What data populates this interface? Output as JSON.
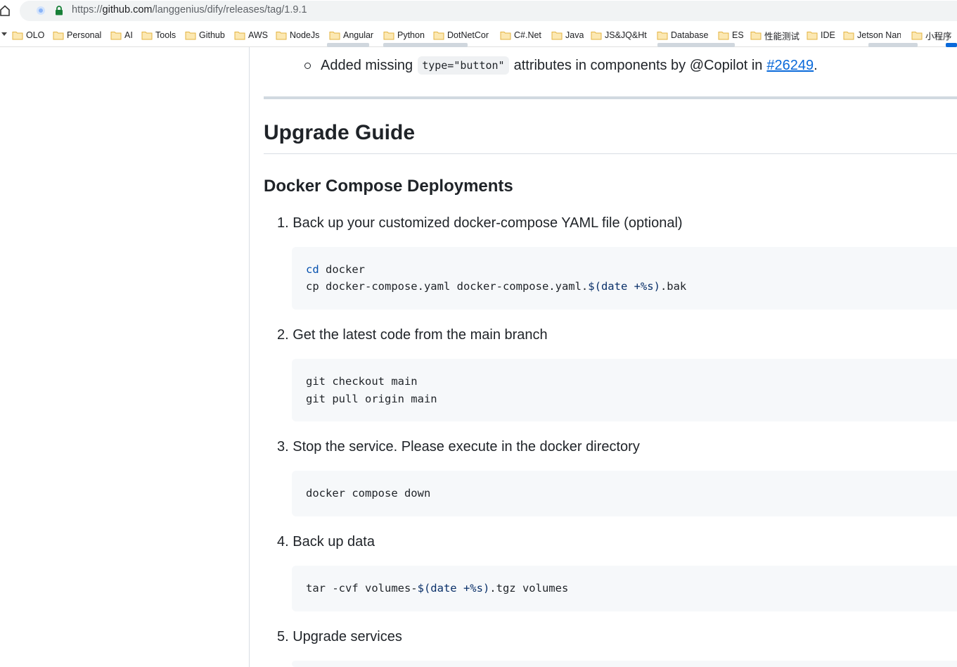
{
  "browser": {
    "url_prefix": "https://",
    "url_host": "github.com",
    "url_path": "/langgenius/dify/releases/tag/1.9.1"
  },
  "bookmarks": [
    {
      "label": "OLO"
    },
    {
      "label": "Personal"
    },
    {
      "label": "AI"
    },
    {
      "label": "Tools"
    },
    {
      "label": "Github"
    },
    {
      "label": "AWS"
    },
    {
      "label": "NodeJs"
    },
    {
      "label": "Angular"
    },
    {
      "label": "Python"
    },
    {
      "label": "DotNetCor"
    },
    {
      "label": "C#.Net"
    },
    {
      "label": "Java"
    },
    {
      "label": "JS&JQ&Ht"
    },
    {
      "label": "Database"
    },
    {
      "label": "ES"
    },
    {
      "label": "性能测试"
    },
    {
      "label": "IDE"
    },
    {
      "label": "Jetson Nan"
    },
    {
      "label": "小程序"
    }
  ],
  "release": {
    "bullet_prefix": "Added missing",
    "bullet_code": "type=\"button\"",
    "bullet_suffix": "attributes in components by @Copilot in",
    "bullet_link": "#26249",
    "bullet_end": ".",
    "h1": "Upgrade Guide",
    "h2": "Docker Compose Deployments",
    "steps": [
      {
        "label": "1. Back up your customized docker-compose YAML file (optional)"
      },
      {
        "label": "2. Get the latest code from the main branch"
      },
      {
        "label": "3. Stop the service. Please execute in the docker directory"
      },
      {
        "label": "4. Back up data"
      },
      {
        "label": "5. Upgrade services"
      }
    ],
    "code": {
      "s1_l1_kw": "cd",
      "s1_l1_rest": " docker",
      "s1_l2_a": "cp docker-compose.yaml docker-compose.yaml.",
      "s1_l2_var": "$(date +%s)",
      "s1_l2_b": ".bak",
      "s2_l1": "git checkout main",
      "s2_l2": "git pull origin main",
      "s3_l1": "docker compose down",
      "s4_a": "tar -cvf volumes-",
      "s4_var": "$(date +%s)",
      "s4_b": ".tgz volumes"
    }
  },
  "colors": {
    "link": "#0969da",
    "code_bg": "#f6f8fa",
    "text": "#1f2328"
  }
}
